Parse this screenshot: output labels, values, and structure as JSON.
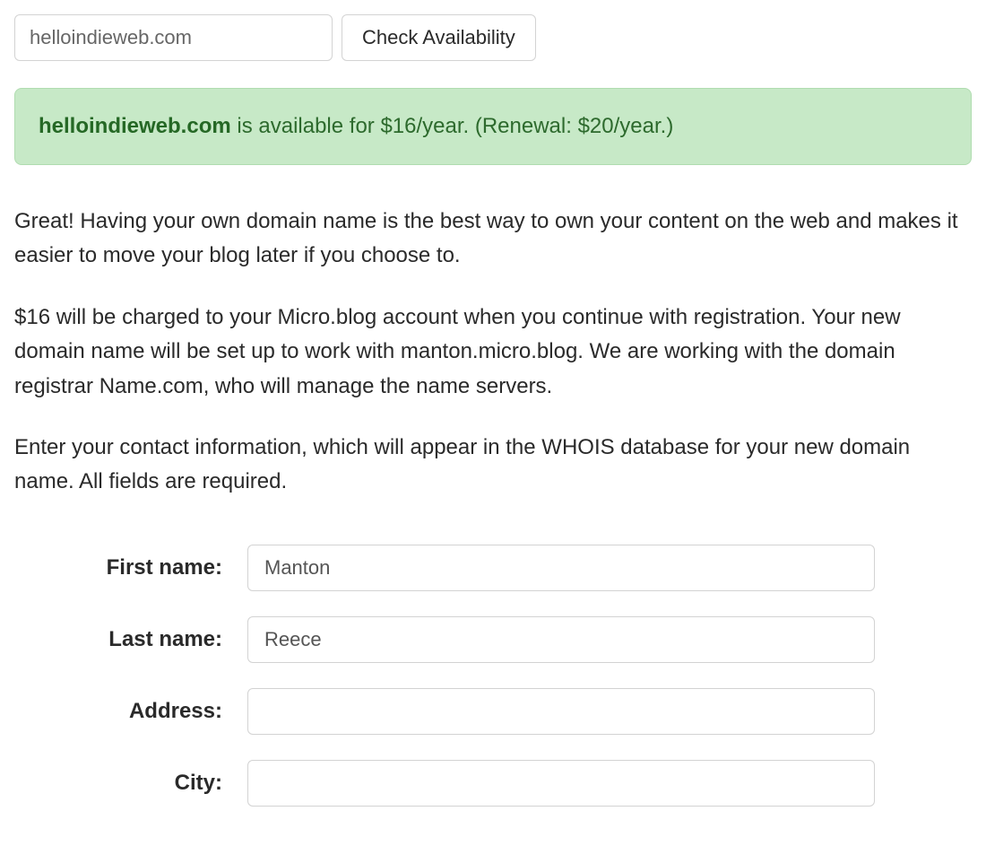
{
  "search": {
    "domain_value": "helloindieweb.com",
    "check_button_label": "Check Availability"
  },
  "availability": {
    "domain": "helloindieweb.com",
    "message_suffix": " is available for $16/year. (Renewal: $20/year.)"
  },
  "paragraphs": {
    "p1": "Great! Having your own domain name is the best way to own your content on the web and makes it easier to move your blog later if you choose to.",
    "p2": "$16 will be charged to your Micro.blog account when you continue with registration. Your new domain name will be set up to work with manton.micro.blog. We are working with the domain registrar Name.com, who will manage the name servers.",
    "p3": "Enter your contact information, which will appear in the WHOIS database for your new domain name. All fields are required."
  },
  "form": {
    "first_name": {
      "label": "First name:",
      "value": "Manton"
    },
    "last_name": {
      "label": "Last name:",
      "value": "Reece"
    },
    "address": {
      "label": "Address:",
      "value": ""
    },
    "city": {
      "label": "City:",
      "value": ""
    }
  }
}
